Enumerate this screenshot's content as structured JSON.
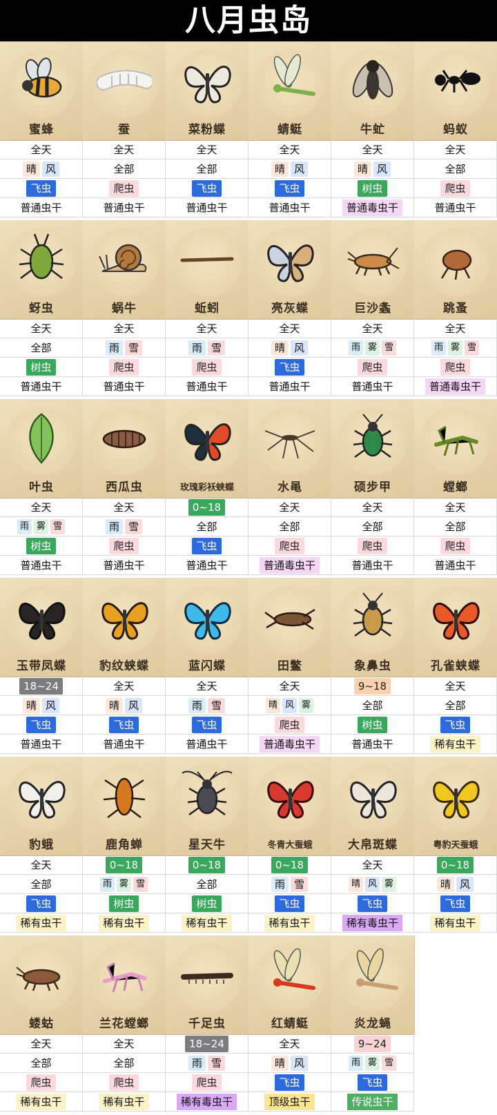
{
  "title": "八月虫岛",
  "colors": {
    "晴": "#fde7da",
    "风": "#d7e6fb",
    "雨": "#d8ecfa",
    "雪": "#fbdada",
    "雾": "#dcf3df",
    "飞虫": "#2d6bdc",
    "爬虫": "#fbd9dd",
    "树虫": "#3aa85c",
    "普通毒虫干": "#f5d6f5",
    "稀有虫干": "#fdf3c6",
    "稀有毒虫干": "#d9a9f5",
    "顶级虫干": "#fce790",
    "传说虫干": "#4caf62",
    "time_green": "#3aa85c",
    "time_gray": "#7b7b80",
    "time_orange": "#fbd2ad",
    "time_pink": "#fbd3d3"
  },
  "bugs": [
    {
      "name": "蜜蜂",
      "time": "全天",
      "weather": [
        "晴",
        "风"
      ],
      "type": "飞虫",
      "bait": "普通虫干",
      "icon": "bee-icon"
    },
    {
      "name": "蚕",
      "time": "全天",
      "weather": [
        "全部"
      ],
      "type": "爬虫",
      "bait": "普通虫干",
      "icon": "silkworm-icon"
    },
    {
      "name": "菜粉蝶",
      "time": "全天",
      "weather": [
        "全部"
      ],
      "type": "飞虫",
      "bait": "普通虫干",
      "icon": "cabbage-butterfly-icon"
    },
    {
      "name": "蜻蜓",
      "time": "全天",
      "weather": [
        "晴",
        "风"
      ],
      "type": "飞虫",
      "bait": "普通虫干",
      "icon": "dragonfly-icon"
    },
    {
      "name": "牛虻",
      "time": "全天",
      "weather": [
        "晴",
        "风"
      ],
      "type": "树虫",
      "bait": "普通毒虫干",
      "icon": "horsefly-icon"
    },
    {
      "name": "蚂蚁",
      "time": "全天",
      "weather": [
        "全部"
      ],
      "type": "爬虫",
      "bait": "普通虫干",
      "icon": "ant-icon"
    },
    {
      "name": "蚜虫",
      "time": "全天",
      "weather": [
        "全部"
      ],
      "type": "树虫",
      "bait": "普通虫干",
      "icon": "aphid-icon"
    },
    {
      "name": "蜗牛",
      "time": "全天",
      "weather": [
        "雨",
        "雪"
      ],
      "type": "爬虫",
      "bait": "普通虫干",
      "icon": "snail-icon"
    },
    {
      "name": "蚯蚓",
      "time": "全天",
      "weather": [
        "雨",
        "雪"
      ],
      "type": "爬虫",
      "bait": "普通虫干",
      "icon": "earthworm-icon"
    },
    {
      "name": "亮灰蝶",
      "time": "全天",
      "weather": [
        "晴",
        "风"
      ],
      "type": "飞虫",
      "bait": "普通虫干",
      "icon": "blue-butterfly-icon"
    },
    {
      "name": "巨沙螽",
      "time": "全天",
      "weather": [
        "雨",
        "雾",
        "雪"
      ],
      "type": "爬虫",
      "bait": "普通虫干",
      "icon": "weta-icon"
    },
    {
      "name": "跳蚤",
      "time": "全天",
      "weather": [
        "雨",
        "雾",
        "雪"
      ],
      "type": "爬虫",
      "bait": "普通毒虫干",
      "icon": "flea-icon"
    },
    {
      "name": "叶虫",
      "time": "全天",
      "weather": [
        "雨",
        "雾",
        "雪"
      ],
      "type": "树虫",
      "bait": "普通虫干",
      "icon": "leaf-insect-icon"
    },
    {
      "name": "西瓜虫",
      "time": "全天",
      "weather": [
        "雨",
        "雪"
      ],
      "type": "爬虫",
      "bait": "普通虫干",
      "icon": "pill-bug-icon"
    },
    {
      "name": "玫瑰彩袄蛱蝶",
      "time": "0~18",
      "timeColor": "time_green",
      "weather": [
        "全部"
      ],
      "type": "飞虫",
      "bait": "普通虫干",
      "icon": "rose-butterfly-icon"
    },
    {
      "name": "水黾",
      "time": "全天",
      "weather": [
        "全部"
      ],
      "type": "爬虫",
      "bait": "普通毒虫干",
      "icon": "water-strider-icon"
    },
    {
      "name": "硕步甲",
      "time": "全天",
      "weather": [
        "全部"
      ],
      "type": "爬虫",
      "bait": "普通虫干",
      "icon": "ground-beetle-icon"
    },
    {
      "name": "螳螂",
      "time": "全天",
      "weather": [
        "全部"
      ],
      "type": "爬虫",
      "bait": "普通虫干",
      "icon": "mantis-icon"
    },
    {
      "name": "玉带凤蝶",
      "time": "18~24",
      "timeColor": "time_gray",
      "weather": [
        "晴",
        "风"
      ],
      "type": "飞虫",
      "bait": "普通虫干",
      "icon": "swallowtail-icon"
    },
    {
      "name": "豹纹蛱蝶",
      "time": "全天",
      "weather": [
        "晴",
        "风"
      ],
      "type": "飞虫",
      "bait": "普通虫干",
      "icon": "fritillary-icon"
    },
    {
      "name": "蓝闪蝶",
      "time": "全天",
      "weather": [
        "雨",
        "雪"
      ],
      "type": "飞虫",
      "bait": "普通虫干",
      "icon": "morpho-icon"
    },
    {
      "name": "田鳖",
      "time": "全天",
      "weather": [
        "晴",
        "风",
        "雾"
      ],
      "type": "爬虫",
      "bait": "普通毒虫干",
      "icon": "water-bug-icon"
    },
    {
      "name": "象鼻虫",
      "time": "9~18",
      "timeColor": "time_orange",
      "weather": [
        "全部"
      ],
      "type": "树虫",
      "bait": "普通虫干",
      "icon": "weevil-icon"
    },
    {
      "name": "孔雀蛱蝶",
      "time": "全天",
      "weather": [
        "全部"
      ],
      "type": "飞虫",
      "bait": "稀有虫干",
      "icon": "peacock-butterfly-icon"
    },
    {
      "name": "豹蛾",
      "time": "全天",
      "weather": [
        "全部"
      ],
      "type": "飞虫",
      "bait": "稀有虫干",
      "icon": "leopard-moth-icon"
    },
    {
      "name": "鹿角蝉",
      "time": "0~18",
      "timeColor": "time_green",
      "weather": [
        "雨",
        "雾",
        "雪"
      ],
      "type": "树虫",
      "bait": "稀有虫干",
      "icon": "cicada-icon"
    },
    {
      "name": "星天牛",
      "time": "0~18",
      "timeColor": "time_green",
      "weather": [
        "全部"
      ],
      "type": "树虫",
      "bait": "稀有虫干",
      "icon": "longhorn-beetle-icon"
    },
    {
      "name": "冬青大蚕蛾",
      "time": "0~18",
      "timeColor": "time_green",
      "weather": [
        "雨",
        "雪"
      ],
      "type": "飞虫",
      "bait": "稀有虫干",
      "icon": "silk-moth-icon"
    },
    {
      "name": "大帛斑蝶",
      "time": "全天",
      "weather": [
        "晴",
        "风",
        "雾"
      ],
      "type": "飞虫",
      "bait": "稀有毒虫干",
      "icon": "tree-nymph-icon"
    },
    {
      "name": "粤豹天蚕蛾",
      "time": "0~18",
      "timeColor": "time_green",
      "weather": [
        "晴",
        "风"
      ],
      "type": "飞虫",
      "bait": "稀有虫干",
      "icon": "yellow-moth-icon"
    },
    {
      "name": "蝼蛄",
      "time": "全天",
      "weather": [
        "全部"
      ],
      "type": "爬虫",
      "bait": "稀有虫干",
      "icon": "mole-cricket-icon"
    },
    {
      "name": "兰花螳螂",
      "time": "全天",
      "weather": [
        "全部"
      ],
      "type": "爬虫",
      "bait": "稀有虫干",
      "icon": "orchid-mantis-icon"
    },
    {
      "name": "千足虫",
      "time": "18~24",
      "timeColor": "time_gray",
      "weather": [
        "雨",
        "雪"
      ],
      "type": "爬虫",
      "bait": "稀有毒虫干",
      "icon": "millipede-icon"
    },
    {
      "name": "红蜻蜓",
      "time": "全天",
      "weather": [
        "晴",
        "风"
      ],
      "type": "飞虫",
      "bait": "顶级虫干",
      "icon": "red-dragonfly-icon"
    },
    {
      "name": "炎龙蝇",
      "time": "9~24",
      "timeColor": "time_pink",
      "weather": [
        "雨",
        "雾",
        "雪"
      ],
      "type": "飞虫",
      "bait": "传说虫干",
      "icon": "dragon-fly-icon"
    }
  ]
}
